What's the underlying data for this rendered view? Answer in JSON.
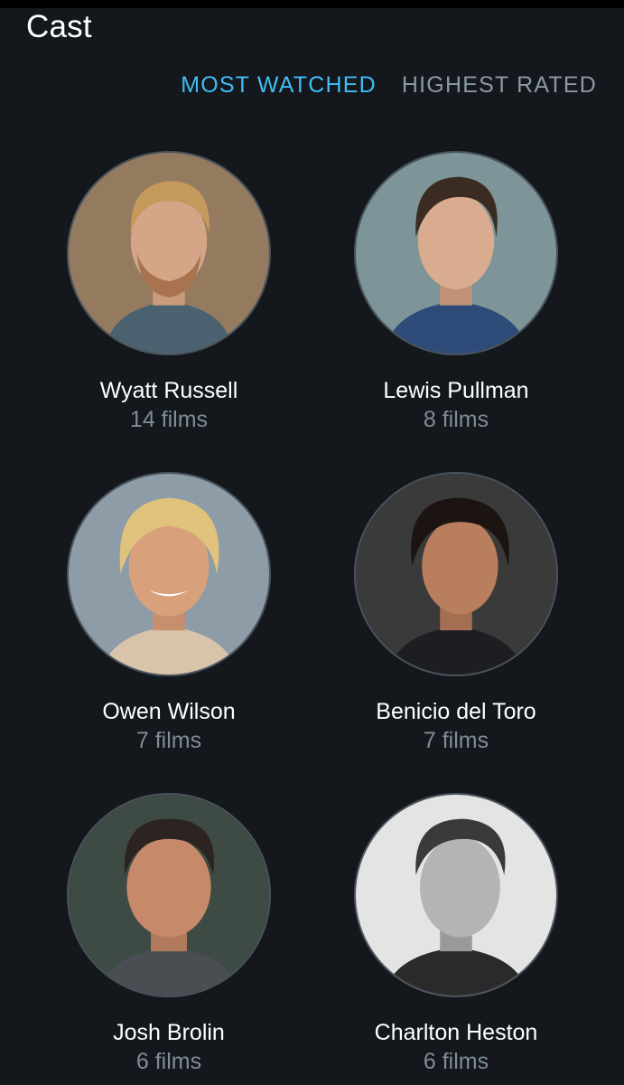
{
  "header": {
    "title": "Cast"
  },
  "tabs": [
    {
      "label": "MOST WATCHED",
      "active": true
    },
    {
      "label": "HIGHEST RATED",
      "active": false
    }
  ],
  "colors": {
    "background": "#14181c",
    "accent": "#40bcf4",
    "muted": "#7f8c99"
  },
  "cast": [
    {
      "name": "Wyatt Russell",
      "films": "14 films",
      "photo": "headshot-icon"
    },
    {
      "name": "Lewis Pullman",
      "films": "8 films",
      "photo": "headshot-icon"
    },
    {
      "name": "Owen Wilson",
      "films": "7 films",
      "photo": "headshot-icon"
    },
    {
      "name": "Benicio del Toro",
      "films": "7 films",
      "photo": "headshot-icon"
    },
    {
      "name": "Josh Brolin",
      "films": "6 films",
      "photo": "headshot-icon"
    },
    {
      "name": "Charlton Heston",
      "films": "6 films",
      "photo": "headshot-icon"
    }
  ]
}
